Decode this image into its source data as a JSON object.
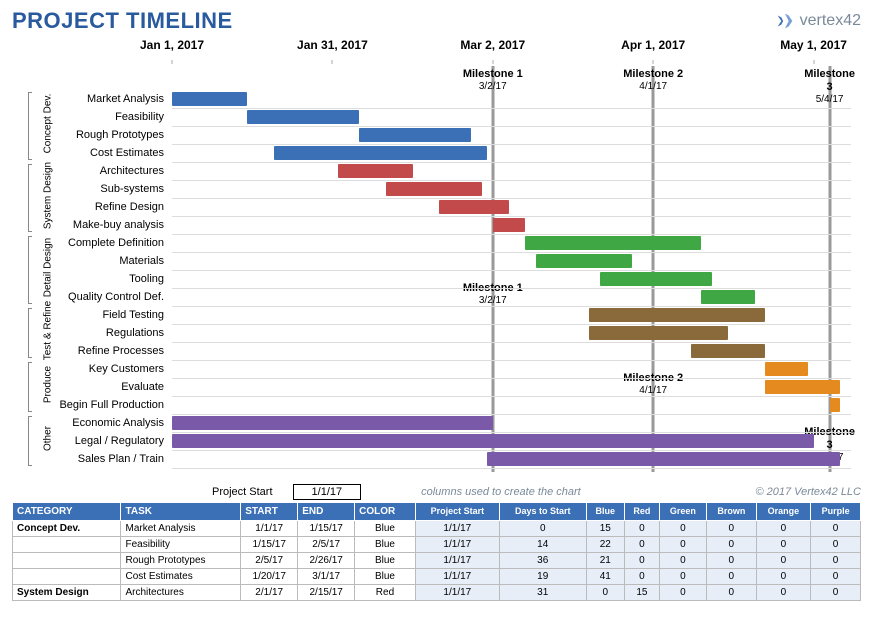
{
  "title": "PROJECT TIMELINE",
  "brand": "vertex42",
  "project_start_label": "Project Start",
  "project_start_value": "1/1/17",
  "hint": "columns used to create the chart",
  "copyright": "© 2017 Vertex42 LLC",
  "axis_ticks": [
    "Jan 1, 2017",
    "Jan 31, 2017",
    "Mar 2, 2017",
    "Apr 1, 2017",
    "May 1, 2017"
  ],
  "milestones": [
    {
      "name": "Milestone 1",
      "date": "3/2/17"
    },
    {
      "name": "Milestone 2",
      "date": "4/1/17"
    },
    {
      "name": "Milestone 3",
      "date": "5/4/17"
    }
  ],
  "milestone_repeats": [
    {
      "name": "Milestone 1",
      "date": "3/2/17"
    },
    {
      "name": "Milestone 2",
      "date": "4/1/17"
    },
    {
      "name": "Milestone 3",
      "date": "5/4/17"
    }
  ],
  "groups": [
    {
      "name": "Concept Dev.",
      "rows": [
        "Market Analysis",
        "Feasibility",
        "Rough Prototypes",
        "Cost Estimates"
      ]
    },
    {
      "name": "System Design",
      "rows": [
        "Architectures",
        "Sub-systems",
        "Refine Design",
        "Make-buy analysis"
      ]
    },
    {
      "name": "Detail Design",
      "rows": [
        "Complete Definition",
        "Materials",
        "Tooling",
        "Quality Control Def."
      ]
    },
    {
      "name": "Test & Refine",
      "rows": [
        "Field Testing",
        "Regulations",
        "Refine Processes"
      ]
    },
    {
      "name": "Produce",
      "rows": [
        "Key Customers",
        "Evaluate",
        "Begin Full Production"
      ]
    },
    {
      "name": "Other",
      "rows": [
        "Economic Analysis",
        "Legal / Regulatory",
        "Sales Plan / Train"
      ]
    }
  ],
  "colors": {
    "blue": "#3b6fb6",
    "red": "#c24a4a",
    "green": "#3fa845",
    "brown": "#8a6a3a",
    "orange": "#e58a1f",
    "purple": "#7a5aa8"
  },
  "chart_data": {
    "type": "gantt",
    "x_axis": {
      "start": "2017-01-01",
      "ticks": [
        "2017-01-01",
        "2017-01-31",
        "2017-03-02",
        "2017-04-01",
        "2017-05-01"
      ]
    },
    "tasks": [
      {
        "group": "Concept Dev.",
        "task": "Market Analysis",
        "start": "2017-01-01",
        "end": "2017-01-15",
        "color": "blue"
      },
      {
        "group": "Concept Dev.",
        "task": "Feasibility",
        "start": "2017-01-15",
        "end": "2017-02-05",
        "color": "blue"
      },
      {
        "group": "Concept Dev.",
        "task": "Rough Prototypes",
        "start": "2017-02-05",
        "end": "2017-02-26",
        "color": "blue"
      },
      {
        "group": "Concept Dev.",
        "task": "Cost Estimates",
        "start": "2017-01-20",
        "end": "2017-03-01",
        "color": "blue"
      },
      {
        "group": "System Design",
        "task": "Architectures",
        "start": "2017-02-01",
        "end": "2017-02-15",
        "color": "red"
      },
      {
        "group": "System Design",
        "task": "Sub-systems",
        "start": "2017-02-10",
        "end": "2017-02-28",
        "color": "red"
      },
      {
        "group": "System Design",
        "task": "Refine Design",
        "start": "2017-02-20",
        "end": "2017-03-05",
        "color": "red"
      },
      {
        "group": "System Design",
        "task": "Make-buy analysis",
        "start": "2017-03-02",
        "end": "2017-03-08",
        "color": "red"
      },
      {
        "group": "Detail Design",
        "task": "Complete Definition",
        "start": "2017-03-08",
        "end": "2017-04-10",
        "color": "green"
      },
      {
        "group": "Detail Design",
        "task": "Materials",
        "start": "2017-03-10",
        "end": "2017-03-28",
        "color": "green"
      },
      {
        "group": "Detail Design",
        "task": "Tooling",
        "start": "2017-03-22",
        "end": "2017-04-12",
        "color": "green"
      },
      {
        "group": "Detail Design",
        "task": "Quality Control Def.",
        "start": "2017-04-10",
        "end": "2017-04-20",
        "color": "green"
      },
      {
        "group": "Test & Refine",
        "task": "Field Testing",
        "start": "2017-03-20",
        "end": "2017-04-22",
        "color": "brown"
      },
      {
        "group": "Test & Refine",
        "task": "Regulations",
        "start": "2017-03-20",
        "end": "2017-04-15",
        "color": "brown"
      },
      {
        "group": "Test & Refine",
        "task": "Refine Processes",
        "start": "2017-04-08",
        "end": "2017-04-22",
        "color": "brown"
      },
      {
        "group": "Produce",
        "task": "Key Customers",
        "start": "2017-04-22",
        "end": "2017-04-30",
        "color": "orange"
      },
      {
        "group": "Produce",
        "task": "Evaluate",
        "start": "2017-04-22",
        "end": "2017-05-06",
        "color": "orange"
      },
      {
        "group": "Produce",
        "task": "Begin Full Production",
        "start": "2017-05-04",
        "end": "2017-05-06",
        "color": "orange"
      },
      {
        "group": "Other",
        "task": "Economic Analysis",
        "start": "2017-01-01",
        "end": "2017-03-02",
        "color": "purple"
      },
      {
        "group": "Other",
        "task": "Legal / Regulatory",
        "start": "2017-01-01",
        "end": "2017-05-01",
        "color": "purple"
      },
      {
        "group": "Other",
        "task": "Sales Plan / Train",
        "start": "2017-03-01",
        "end": "2017-05-06",
        "color": "purple"
      }
    ],
    "milestones": [
      {
        "name": "Milestone 1",
        "date": "2017-03-02"
      },
      {
        "name": "Milestone 2",
        "date": "2017-04-01"
      },
      {
        "name": "Milestone 3",
        "date": "2017-05-04"
      }
    ]
  },
  "table": {
    "headers_left": [
      "CATEGORY",
      "TASK",
      "START",
      "END",
      "COLOR"
    ],
    "headers_right": [
      "Project Start",
      "Days to Start",
      "Blue",
      "Red",
      "Green",
      "Brown",
      "Orange",
      "Purple"
    ],
    "rows": [
      {
        "category": "Concept Dev.",
        "task": "Market Analysis",
        "start": "1/1/17",
        "end": "1/15/17",
        "color": "Blue",
        "ps": "1/1/17",
        "dts": 0,
        "blue": 15,
        "red": 0,
        "green": 0,
        "brown": 0,
        "orange": 0,
        "purple": 0
      },
      {
        "category": "",
        "task": "Feasibility",
        "start": "1/15/17",
        "end": "2/5/17",
        "color": "Blue",
        "ps": "1/1/17",
        "dts": 14,
        "blue": 22,
        "red": 0,
        "green": 0,
        "brown": 0,
        "orange": 0,
        "purple": 0
      },
      {
        "category": "",
        "task": "Rough Prototypes",
        "start": "2/5/17",
        "end": "2/26/17",
        "color": "Blue",
        "ps": "1/1/17",
        "dts": 36,
        "blue": 21,
        "red": 0,
        "green": 0,
        "brown": 0,
        "orange": 0,
        "purple": 0
      },
      {
        "category": "",
        "task": "Cost Estimates",
        "start": "1/20/17",
        "end": "3/1/17",
        "color": "Blue",
        "ps": "1/1/17",
        "dts": 19,
        "blue": 41,
        "red": 0,
        "green": 0,
        "brown": 0,
        "orange": 0,
        "purple": 0
      },
      {
        "category": "System Design",
        "task": "Architectures",
        "start": "2/1/17",
        "end": "2/15/17",
        "color": "Red",
        "ps": "1/1/17",
        "dts": 31,
        "blue": 0,
        "red": 15,
        "green": 0,
        "brown": 0,
        "orange": 0,
        "purple": 0
      }
    ]
  }
}
